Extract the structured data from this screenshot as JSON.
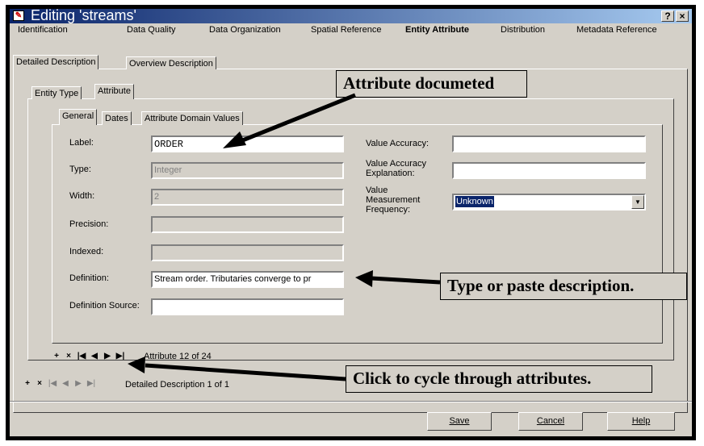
{
  "window": {
    "title": "Editing 'streams'",
    "help_btn": "?",
    "close_btn": "×"
  },
  "main_tabs": [
    "Identification",
    "Data Quality",
    "Data Organization",
    "Spatial Reference",
    "Entity Attribute",
    "Distribution",
    "Metadata Reference"
  ],
  "sub_tabs": [
    "Detailed Description",
    "Overview Description"
  ],
  "entity_tabs": [
    "Entity Type",
    "Attribute"
  ],
  "attr_tabs": [
    "General",
    "Dates",
    "Attribute Domain Values"
  ],
  "fields": {
    "label": {
      "label": "Label:",
      "value": "ORDER"
    },
    "type": {
      "label": "Type:",
      "value": "Integer"
    },
    "width": {
      "label": "Width:",
      "value": "2"
    },
    "precision": {
      "label": "Precision:",
      "value": ""
    },
    "indexed": {
      "label": "Indexed:",
      "value": ""
    },
    "definition": {
      "label": "Definition:",
      "value": "Stream order.  Tributaries converge to pr"
    },
    "definition_source": {
      "label": "Definition Source:",
      "value": ""
    },
    "value_accuracy": {
      "label": "Value Accuracy:",
      "value": ""
    },
    "value_accuracy_expl": {
      "label_1": "Value Accuracy",
      "label_2": "Explanation:",
      "value": ""
    },
    "measurement_freq": {
      "label_1": "Value",
      "label_2": "Measurement",
      "label_3": "Frequency:",
      "value": "Unknown"
    }
  },
  "nav": {
    "attribute_status": "Attribute 12 of 24",
    "detail_status": "Detailed Description 1 of 1",
    "icons": {
      "add": "+",
      "delete": "×",
      "first": "|◀",
      "prev": "◀",
      "next": "▶",
      "last": "▶|"
    }
  },
  "buttons": {
    "save": "Save",
    "cancel": "Cancel",
    "help": "Help"
  },
  "callouts": {
    "documented": "Attribute documeted",
    "type_paste": "Type or paste description.",
    "cycle": "Click to cycle through attributes."
  }
}
